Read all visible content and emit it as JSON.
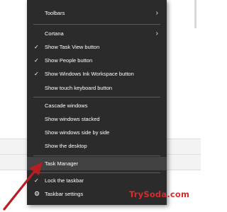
{
  "menu": {
    "toolbars": "Toolbars",
    "cortana": "Cortana",
    "task_view": "Show Task View button",
    "people": "Show People button",
    "ink": "Show Windows Ink Workspace button",
    "touch_keyboard": "Show touch keyboard button",
    "cascade": "Cascade windows",
    "stacked": "Show windows stacked",
    "side_by_side": "Show windows side by side",
    "desktop": "Show the desktop",
    "task_manager": "Task Manager",
    "lock_taskbar": "Lock the taskbar",
    "taskbar_settings": "Taskbar settings"
  },
  "watermark": "TrySoda.com",
  "colors": {
    "menu_background": "#2b2b2b",
    "highlight": "#414141",
    "arrow": "#b81d24",
    "watermark": "#d92b2b"
  },
  "icons": {
    "submenu": "chevron-right-icon",
    "check": "checkmark-icon",
    "settings": "gear-icon"
  }
}
